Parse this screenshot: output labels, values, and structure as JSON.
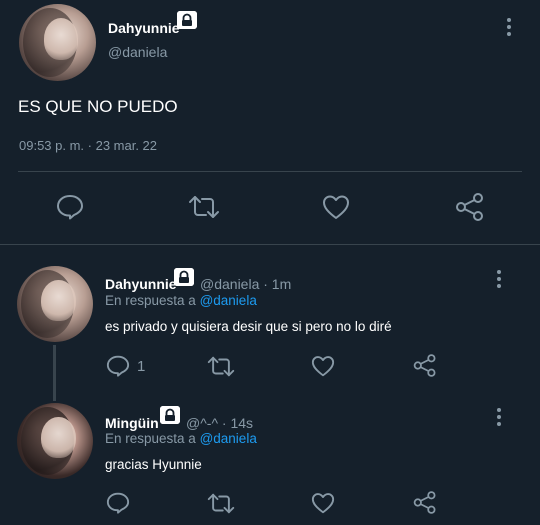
{
  "main_tweet": {
    "author_name": "Dahyunnie",
    "handle": "@daniela",
    "text": "ES QUE NO PUEDO",
    "timestamp": "09:53 p. m. · 23 mar. 22"
  },
  "replies": [
    {
      "author_name": "Dahyunnie",
      "meta": "@daniela · 1m",
      "reply_prefix": "En respuesta a",
      "reply_to": "@daniela",
      "text": "es privado y quisiera desir que si pero no lo diré",
      "reply_count": "1"
    },
    {
      "author_name": "Mingüin",
      "meta": "@^-^ · 14s",
      "reply_prefix": "En respuesta a",
      "reply_to": "@daniela",
      "text": "gracias Hyunnie",
      "reply_count": ""
    }
  ],
  "icons": {
    "reply": "reply-icon",
    "retweet": "retweet-icon",
    "like": "heart-icon",
    "share": "share-icon",
    "lock": "lock-icon",
    "more": "more-icon"
  },
  "colors": {
    "background": "#15202b",
    "text": "#ffffff",
    "secondary": "#8899a6",
    "link": "#1d9bf0",
    "divider": "#38444d"
  }
}
